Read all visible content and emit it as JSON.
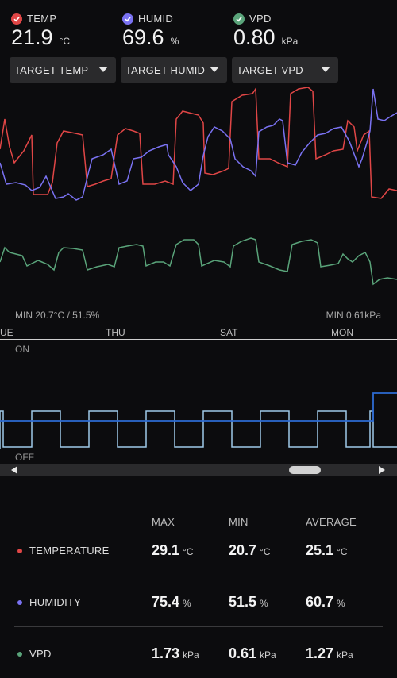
{
  "metrics": [
    {
      "label": "TEMP",
      "value": "21.9",
      "unit": "°C",
      "color": "#e04646"
    },
    {
      "label": "HUMID",
      "value": "69.6",
      "unit": "%",
      "color": "#7a72f2"
    },
    {
      "label": "VPD",
      "value": "0.80",
      "unit": "kPa",
      "color": "#5aa47a"
    }
  ],
  "dropdowns": [
    "TARGET TEMP",
    "TARGET HUMID",
    "TARGET VPD"
  ],
  "chart": {
    "min_left": "MIN 20.7°C / 51.5%",
    "min_right": "MIN 0.61kPa",
    "days": [
      "UE",
      "THU",
      "SAT",
      "MON"
    ],
    "on_label": "ON",
    "off_label": "OFF"
  },
  "stats": {
    "headers": {
      "max": "MAX",
      "min": "MIN",
      "avg": "AVERAGE"
    },
    "rows": [
      {
        "label": "TEMPERATURE",
        "max": "29.1",
        "min": "20.7",
        "avg": "25.1",
        "unit": "°C",
        "color": "#e04646"
      },
      {
        "label": "HUMIDITY",
        "max": "75.4",
        "min": "51.5",
        "avg": "60.7",
        "unit": "%",
        "color": "#7a72f2"
      },
      {
        "label": "VPD",
        "max": "1.73",
        "min": "0.61",
        "avg": "1.27",
        "unit": "kPa",
        "color": "#5aa47a"
      }
    ]
  },
  "colors": {
    "temp": "#e04646",
    "humid": "#7a72f2",
    "vpd": "#5aa47a",
    "device": "#9ec9e8",
    "device_blue": "#2d6bd3"
  }
}
